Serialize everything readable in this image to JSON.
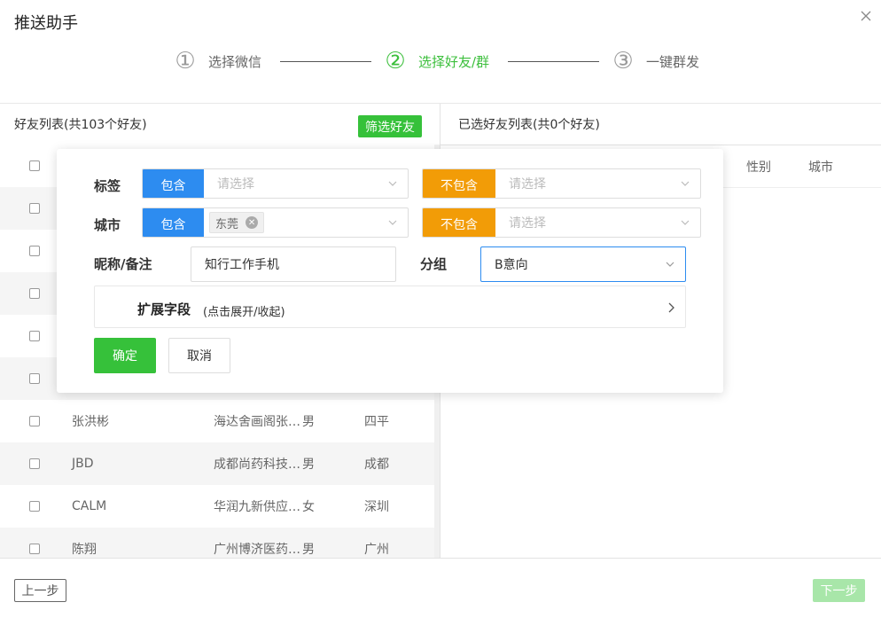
{
  "dialog": {
    "title": "推送助手"
  },
  "steps": [
    {
      "num": "1",
      "label": "选择微信",
      "active": false
    },
    {
      "num": "2",
      "label": "选择好友/群",
      "active": true
    },
    {
      "num": "3",
      "label": "一键群发",
      "active": false
    }
  ],
  "left_panel": {
    "title": "好友列表(共103个好友)",
    "filter_button": "筛选好友"
  },
  "right_panel": {
    "title": "已选好友列表(共0个好友)",
    "columns": {
      "gender": "性别",
      "city": "城市"
    }
  },
  "friends": [
    {
      "name": "",
      "note": "",
      "gender": "",
      "city": ""
    },
    {
      "name": "",
      "note": "",
      "gender": "",
      "city": ""
    },
    {
      "name": "",
      "note": "",
      "gender": "",
      "city": ""
    },
    {
      "name": "",
      "note": "",
      "gender": "",
      "city": ""
    },
    {
      "name": "",
      "note": "",
      "gender": "",
      "city": ""
    },
    {
      "name": "张洪彬",
      "note": "海达舍画阁张先生",
      "gender": "男",
      "city": "四平"
    },
    {
      "name": "JBD",
      "note": "成都尚药科技有限公司",
      "gender": "男",
      "city": "成都"
    },
    {
      "name": "CALM",
      "note": "华润九新供应链管理",
      "gender": "女",
      "city": "深圳"
    },
    {
      "name": "陈翔",
      "note": "广州博济医药有限公司",
      "gender": "男",
      "city": "广州"
    }
  ],
  "filter": {
    "tag_label": "标签",
    "city_label": "城市",
    "nickname_label": "昵称/备注",
    "group_label": "分组",
    "include": "包含",
    "exclude": "不包含",
    "placeholder": "请选择",
    "city_chip": "东莞",
    "nickname_value": "知行工作手机",
    "group_value": "B意向",
    "expand_title": "扩展字段",
    "expand_hint": "(点击展开/收起)",
    "confirm": "确定",
    "cancel": "取消"
  },
  "footer": {
    "prev": "上一步",
    "next": "下一步"
  },
  "colors": {
    "green": "#36c13a",
    "blue": "#2d8cf0",
    "orange": "#f29c07"
  }
}
